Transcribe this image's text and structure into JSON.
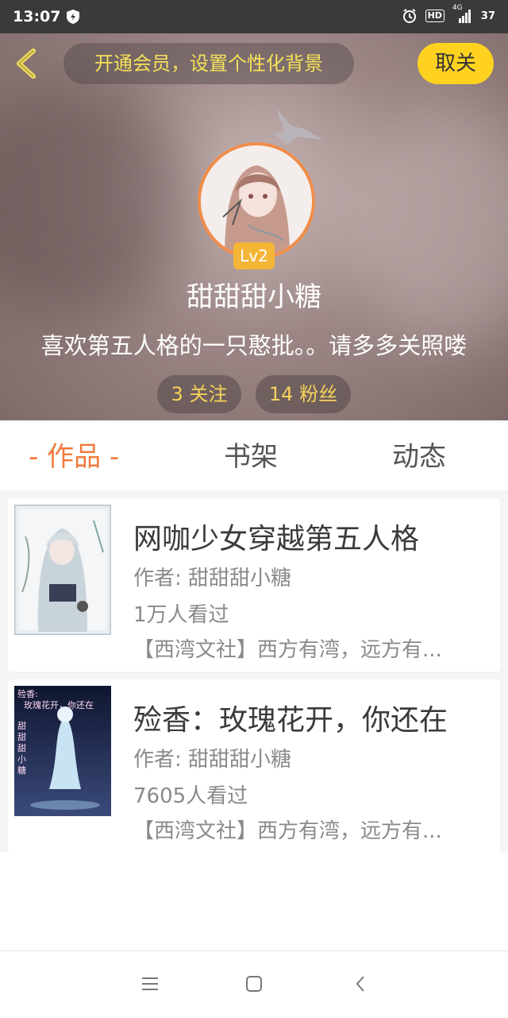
{
  "status": {
    "time": "13:07",
    "network": "4G",
    "hd": "HD",
    "battery": "37"
  },
  "header": {
    "vip_prompt": "开通会员，设置个性化背景",
    "follow_button": "取关",
    "level": "Lv2",
    "username": "甜甜甜小糖",
    "bio": "喜欢第五人格的一只憨批。。请多多关照喽",
    "following": "3 关注",
    "followers": "14 粉丝"
  },
  "tabs": [
    "- 作品 -",
    "书架",
    "动态"
  ],
  "works": [
    {
      "title": "网咖少女穿越第五人格",
      "author": "作者: 甜甜甜小糖",
      "views": "1万人看过",
      "desc": "【西湾文社】西方有湾，远方有..."
    },
    {
      "title": "殓香：玫瑰花开，你还在",
      "author": "作者: 甜甜甜小糖",
      "views": "7605人看过",
      "desc": "【西湾文社】西方有湾，远方有..."
    }
  ],
  "cover2_text": [
    "殓香:",
    "玫瑰花开，你还在",
    "甜甜甜小糖"
  ],
  "colors": {
    "accent": "#f07a3d",
    "yellow": "#ffd21f",
    "level": "#f4b637"
  },
  "icons": [
    "shield-icon",
    "alarm-icon",
    "signal-icon",
    "back-icon",
    "crown-icon",
    "menu-icon",
    "home-icon",
    "nav-back-icon"
  ]
}
